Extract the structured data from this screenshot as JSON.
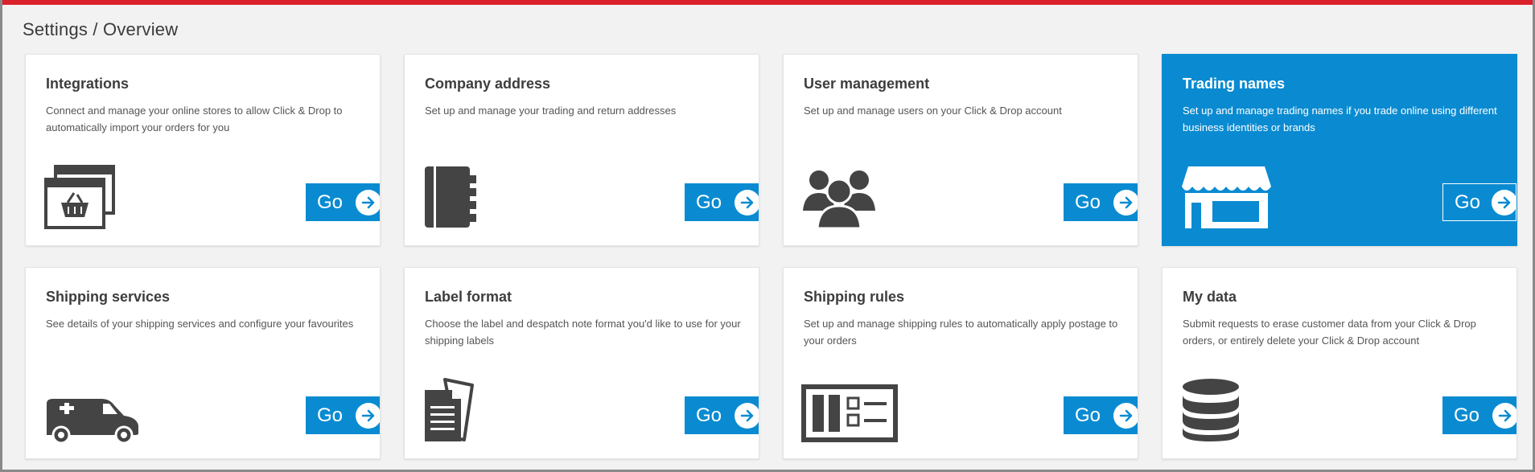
{
  "header": {
    "breadcrumb": "Settings / Overview"
  },
  "colors": {
    "brand_red": "#da202a",
    "accent_blue": "#0a8bd1",
    "icon_dark": "#444444"
  },
  "cards": [
    {
      "title": "Integrations",
      "description": "Connect and manage your online stores to allow Click & Drop to automatically import your orders for you",
      "icon": "store-windows-icon",
      "button": "Go"
    },
    {
      "title": "Company address",
      "description": "Set up and manage your trading and return addresses",
      "icon": "address-book-icon",
      "button": "Go"
    },
    {
      "title": "User management",
      "description": "Set up and manage users on your Click & Drop account",
      "icon": "users-icon",
      "button": "Go"
    },
    {
      "title": "Trading names",
      "description": "Set up and manage trading names if you trade online using different business identities or brands",
      "icon": "shopfront-icon",
      "button": "Go",
      "active": true
    },
    {
      "title": "Shipping services",
      "description": "See details of your shipping services and configure your favourites",
      "icon": "delivery-van-icon",
      "button": "Go"
    },
    {
      "title": "Label format",
      "description": "Choose the label and despatch note format you'd like to use for your shipping labels",
      "icon": "documents-icon",
      "button": "Go"
    },
    {
      "title": "Shipping rules",
      "description": "Set up and manage shipping rules to automatically apply postage to your orders",
      "icon": "rules-icon",
      "button": "Go"
    },
    {
      "title": "My data",
      "description": "Submit requests to erase customer data from your Click & Drop orders, or entirely delete your Click & Drop account",
      "icon": "database-icon",
      "button": "Go"
    }
  ]
}
